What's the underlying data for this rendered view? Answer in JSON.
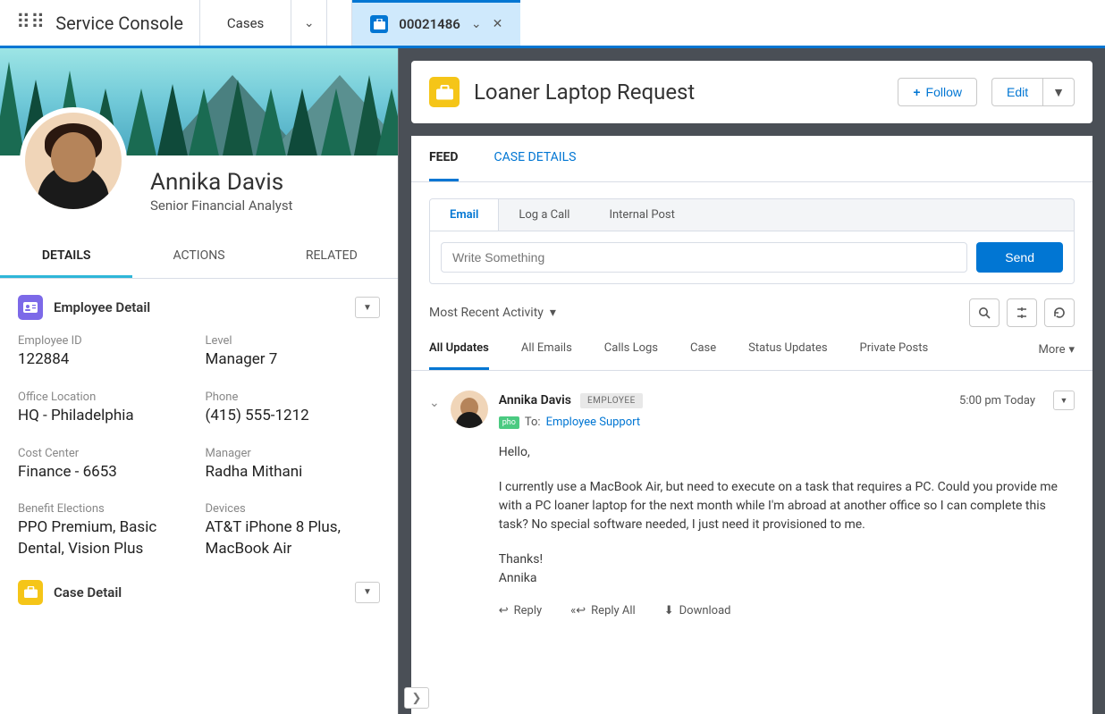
{
  "app": {
    "title": "Service Console"
  },
  "nav": {
    "cases": "Cases"
  },
  "tab": {
    "number": "00021486"
  },
  "person": {
    "name": "Annika Davis",
    "title": "Senior Financial Analyst"
  },
  "leftTabs": {
    "details": "DETAILS",
    "actions": "ACTIONS",
    "related": "RELATED"
  },
  "empSection": {
    "title": "Employee Detail"
  },
  "caseDetailSection": {
    "title": "Case Detail"
  },
  "fields": {
    "empId": {
      "label": "Employee ID",
      "value": "122884"
    },
    "level": {
      "label": "Level",
      "value": "Manager 7"
    },
    "office": {
      "label": "Office Location",
      "value": "HQ - Philadelphia"
    },
    "phone": {
      "label": "Phone",
      "value": "(415) 555-1212"
    },
    "cost": {
      "label": "Cost Center",
      "value": "Finance - 6653"
    },
    "manager": {
      "label": "Manager",
      "value": "Radha Mithani"
    },
    "benefits": {
      "label": "Benefit Elections",
      "value": "PPO Premium, Basic Dental, Vision Plus"
    },
    "devices": {
      "label": "Devices",
      "value": "AT&T iPhone 8 Plus, MacBook Air"
    }
  },
  "caseHeader": {
    "title": "Loaner Laptop Request",
    "follow": "Follow",
    "edit": "Edit"
  },
  "feedTabs": {
    "feed": "FEED",
    "caseDetails": "CASE DETAILS"
  },
  "composer": {
    "tabs": {
      "email": "Email",
      "log": "Log a Call",
      "internal": "Internal Post"
    },
    "placeholder": "Write Something",
    "send": "Send"
  },
  "filter": {
    "label": "Most Recent Activity"
  },
  "feedFilters": {
    "all": "All Updates",
    "emails": "All Emails",
    "calls": "Calls Logs",
    "case": "Case",
    "status": "Status Updates",
    "private": "Private Posts",
    "more": "More"
  },
  "post": {
    "author": "Annika Davis",
    "badge": "EMPLOYEE",
    "time": "5:00 pm Today",
    "phoBadge": "pho",
    "toLabel": "To:",
    "toLink": "Employee Support",
    "p1": "Hello,",
    "p2": "I currently use a MacBook Air, but need to execute on a task that requires a PC.  Could you provide me with a PC loaner laptop for the next month while I'm abroad at another office so I can complete this task?  No special software needed, I just need it provisioned to me.",
    "p3": "Thanks!",
    "p4": "Annika",
    "actions": {
      "reply": "Reply",
      "replyAll": "Reply All",
      "download": "Download"
    }
  }
}
